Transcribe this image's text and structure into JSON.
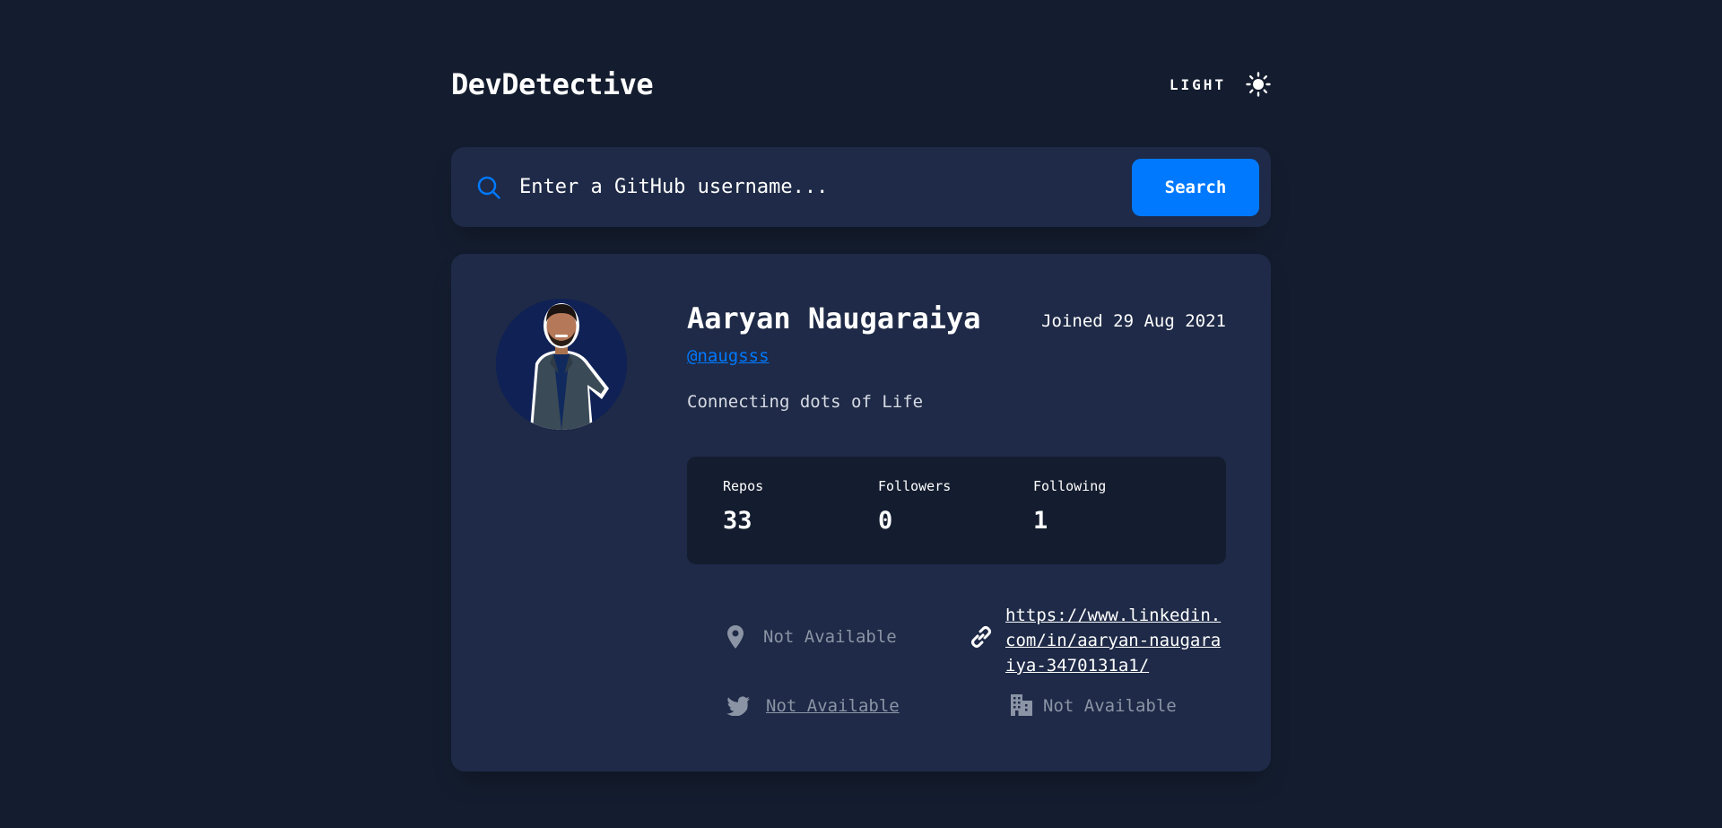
{
  "app": {
    "logo": "DevDetective",
    "theme_toggle_label": "LIGHT"
  },
  "search": {
    "placeholder": "Enter a GitHub username...",
    "button_label": "Search"
  },
  "profile": {
    "name": "Aaryan Naugaraiya",
    "joined": "Joined 29 Aug 2021",
    "username": "@naugsss",
    "bio": "Connecting dots of Life",
    "stats": [
      {
        "label": "Repos",
        "value": "33"
      },
      {
        "label": "Followers",
        "value": "0"
      },
      {
        "label": "Following",
        "value": "1"
      }
    ],
    "location": "Not Available",
    "website": "https://www.linkedin.com/in/aaryan-naugaraiya-3470131a1/",
    "twitter": "Not Available",
    "company": "Not Available"
  },
  "colors": {
    "background": "#141d2f",
    "card": "#1e2a47",
    "accent": "#0079ff",
    "muted": "#8b94a5"
  },
  "icons": {
    "theme": "sun-icon",
    "search": "search-icon",
    "location": "location-pin-icon",
    "website": "link-icon",
    "twitter": "twitter-icon",
    "company": "building-icon"
  }
}
